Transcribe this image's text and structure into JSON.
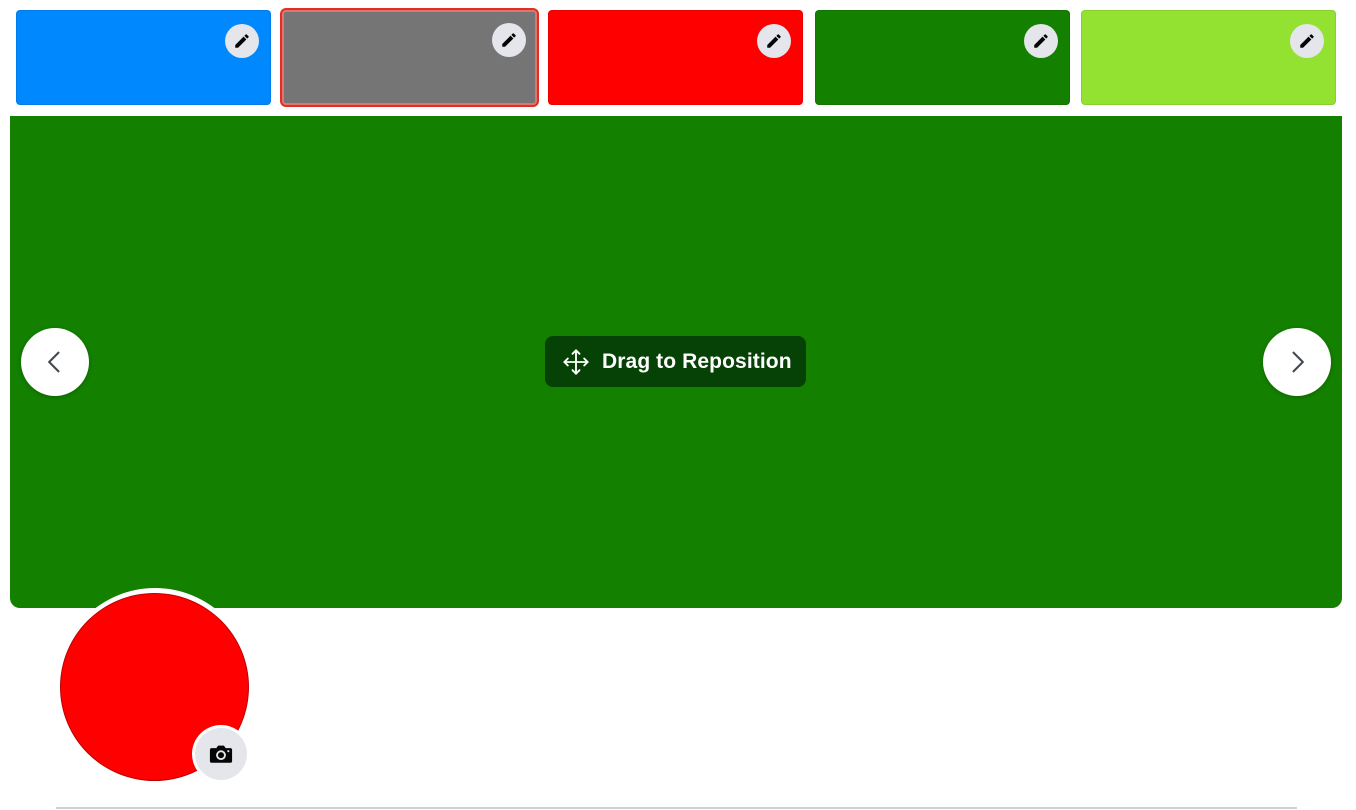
{
  "swatches": [
    {
      "color": "#0088ff",
      "selected": false,
      "edit_icon": "pencil-icon"
    },
    {
      "color": "#757575",
      "selected": true,
      "edit_icon": "pencil-icon"
    },
    {
      "color": "#ff0000",
      "selected": false,
      "edit_icon": "pencil-icon"
    },
    {
      "color": "#138000",
      "selected": false,
      "edit_icon": "pencil-icon"
    },
    {
      "color": "#93e232",
      "selected": false,
      "edit_icon": "pencil-icon"
    }
  ],
  "cover": {
    "color": "#138000",
    "drag_label": "Drag to Reposition",
    "drag_icon": "move-arrows-icon",
    "prev_icon": "chevron-left-icon",
    "next_icon": "chevron-right-icon"
  },
  "avatar": {
    "color": "#ff0000",
    "camera_icon": "camera-icon"
  }
}
